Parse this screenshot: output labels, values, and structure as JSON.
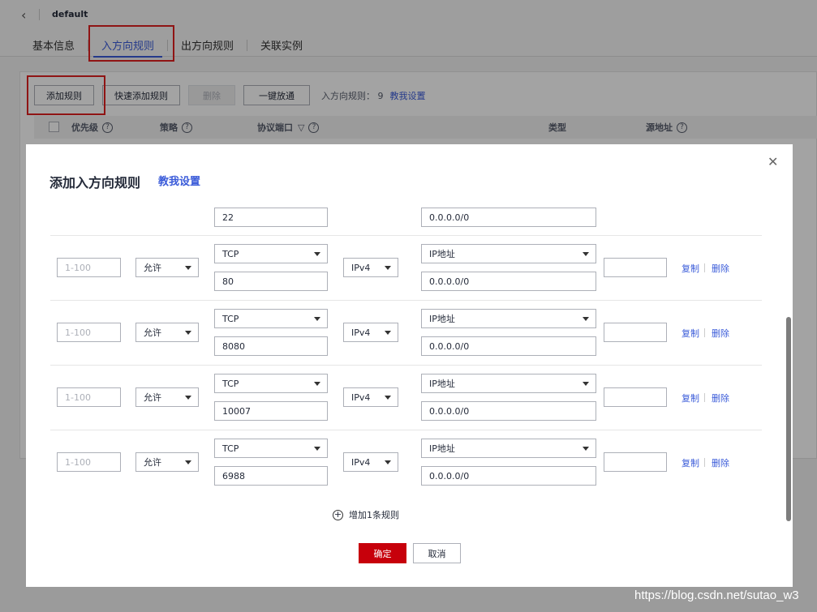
{
  "header": {
    "back_icon": "chevron-left-icon",
    "title": "default"
  },
  "tabs": [
    {
      "label": "基本信息",
      "active": false
    },
    {
      "label": "入方向规则",
      "active": true
    },
    {
      "label": "出方向规则",
      "active": false
    },
    {
      "label": "关联实例",
      "active": false
    }
  ],
  "toolbar": {
    "add_rule": "添加规则",
    "quick_add": "快速添加规则",
    "delete": "删除",
    "allow_all": "一键放通",
    "info": "入方向规则： 9",
    "help_link": "教我设置"
  },
  "table": {
    "columns": [
      "优先级",
      "策略",
      "协议端口",
      "类型",
      "源地址"
    ]
  },
  "modal": {
    "title": "添加入方向规则",
    "help_link": "教我设置",
    "close_icon": "close-icon",
    "partial_row": {
      "port": "22",
      "address": "0.0.0.0/0"
    },
    "rows": [
      {
        "priority_placeholder": "1-100",
        "policy": "允许",
        "protocol": "TCP",
        "port": "80",
        "type": "IPv4",
        "source_type": "IP地址",
        "address": "0.0.0.0/0",
        "copy": "复制",
        "delete": "删除"
      },
      {
        "priority_placeholder": "1-100",
        "policy": "允许",
        "protocol": "TCP",
        "port": "8080",
        "type": "IPv4",
        "source_type": "IP地址",
        "address": "0.0.0.0/0",
        "copy": "复制",
        "delete": "删除"
      },
      {
        "priority_placeholder": "1-100",
        "policy": "允许",
        "protocol": "TCP",
        "port": "10007",
        "type": "IPv4",
        "source_type": "IP地址",
        "address": "0.0.0.0/0",
        "copy": "复制",
        "delete": "删除"
      },
      {
        "priority_placeholder": "1-100",
        "policy": "允许",
        "protocol": "TCP",
        "port": "6988",
        "type": "IPv4",
        "source_type": "IP地址",
        "address": "0.0.0.0/0",
        "copy": "复制",
        "delete": "删除"
      }
    ],
    "add_row": "增加1条规则",
    "ok": "确定",
    "cancel": "取消"
  },
  "watermark": "https://blog.csdn.net/sutao_w3",
  "colors": {
    "primary": "#c7000b",
    "link": "#3a5bd9",
    "highlight_box": "#e02020"
  }
}
